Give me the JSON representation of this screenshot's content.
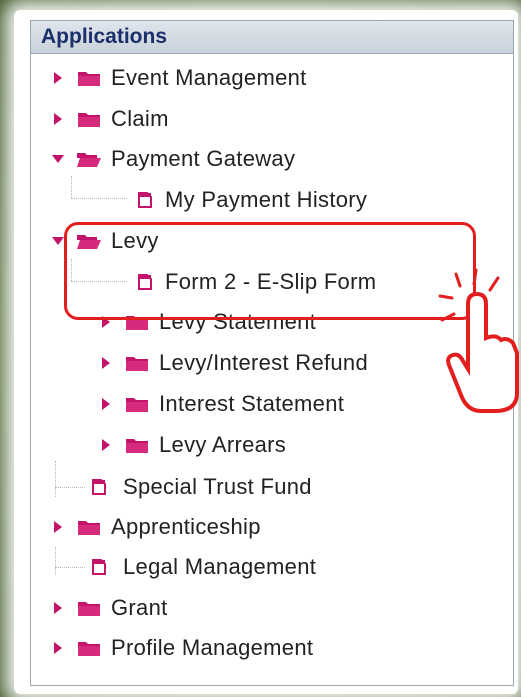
{
  "header": {
    "title": "Applications"
  },
  "tree": {
    "event_management": "Event Management",
    "claim": "Claim",
    "payment_gateway": "Payment Gateway",
    "my_payment_history": "My Payment History",
    "levy": "Levy",
    "form2_eslip": "Form 2 - E-Slip Form",
    "levy_statement": "Levy Statement",
    "levy_interest_refund": "Levy/Interest Refund",
    "interest_statement": "Interest Statement",
    "levy_arrears": "Levy Arrears",
    "special_trust_fund": "Special Trust Fund",
    "apprenticeship": "Apprenticeship",
    "legal_management": "Legal Management",
    "grant": "Grant",
    "profile_management": "Profile Management"
  },
  "colors": {
    "arrow": "#c4136a",
    "folder": "#c4136a",
    "highlight": "#e21e1e",
    "header_text": "#1b2f6a"
  },
  "icons": {
    "collapsed": "caret-right-icon",
    "expanded": "caret-down-icon",
    "folder": "folder-icon",
    "open_folder": "folder-open-icon",
    "page": "page-icon",
    "pointer": "hand-pointer-icon"
  }
}
